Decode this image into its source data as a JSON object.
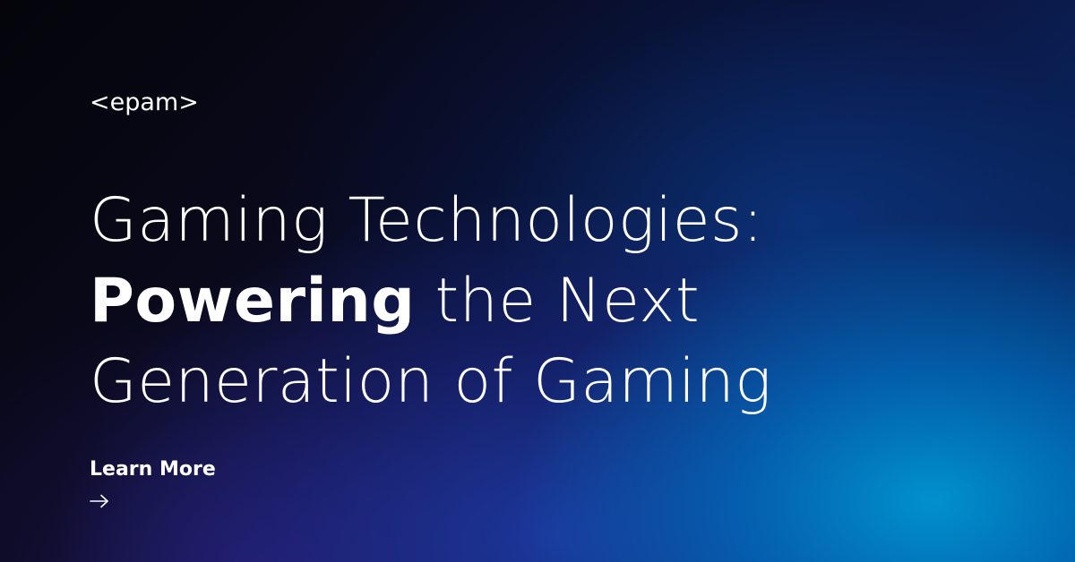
{
  "brand": {
    "logo_text": "<epam>"
  },
  "headline": {
    "line1": "Gaming Technologies:",
    "line2_bold": "Powering",
    "line2_rest": " the Next",
    "line3": "Generation of Gaming"
  },
  "cta": {
    "label": "Learn More",
    "icon": "arrow-right-icon"
  },
  "colors": {
    "text": "#ffffff",
    "background_dark": "#04040a",
    "background_accent": "#0096d2"
  }
}
